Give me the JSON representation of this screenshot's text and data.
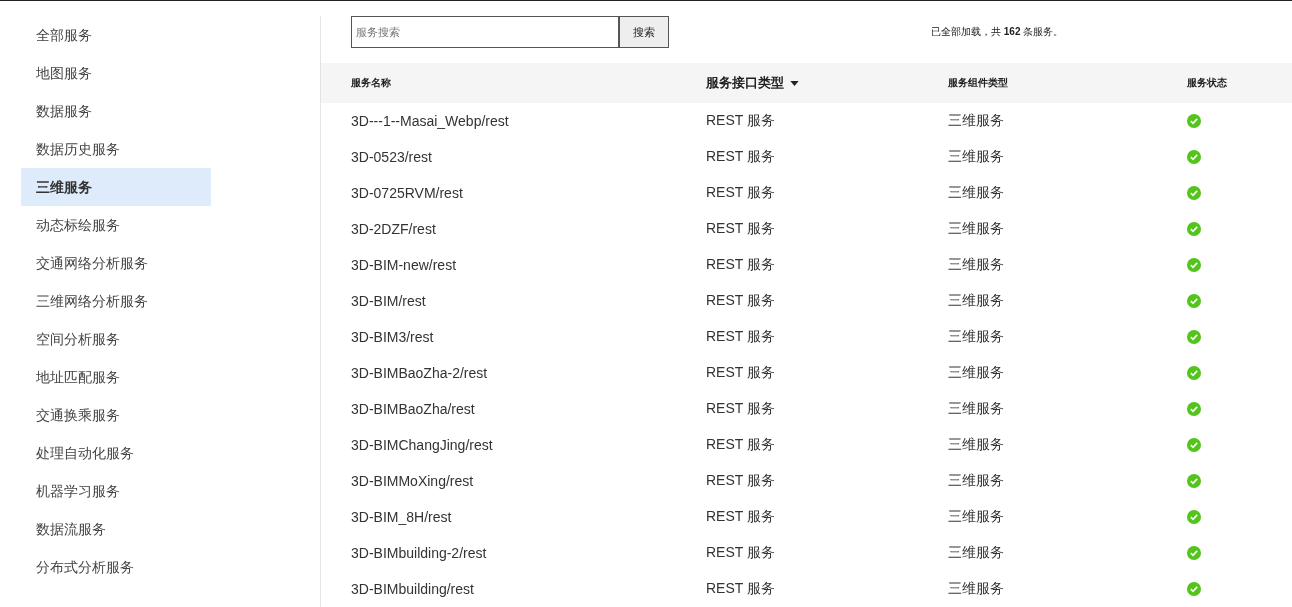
{
  "sidebar": {
    "items": [
      {
        "label": "全部服务",
        "selected": false
      },
      {
        "label": "地图服务",
        "selected": false
      },
      {
        "label": "数据服务",
        "selected": false
      },
      {
        "label": "数据历史服务",
        "selected": false
      },
      {
        "label": "三维服务",
        "selected": true
      },
      {
        "label": "动态标绘服务",
        "selected": false
      },
      {
        "label": "交通网络分析服务",
        "selected": false
      },
      {
        "label": "三维网络分析服务",
        "selected": false
      },
      {
        "label": "空间分析服务",
        "selected": false
      },
      {
        "label": "地址匹配服务",
        "selected": false
      },
      {
        "label": "交通换乘服务",
        "selected": false
      },
      {
        "label": "处理自动化服务",
        "selected": false
      },
      {
        "label": "机器学习服务",
        "selected": false
      },
      {
        "label": "数据流服务",
        "selected": false
      },
      {
        "label": "分布式分析服务",
        "selected": false
      }
    ]
  },
  "search": {
    "placeholder": "服务搜索",
    "button": "搜索"
  },
  "summary": "已全部加载，共 **162** 条服务。",
  "table": {
    "columns": [
      {
        "label": "服务名称",
        "sorted": false
      },
      {
        "label": "服务接口类型",
        "sorted": true
      },
      {
        "label": "服务组件类型",
        "sorted": false
      },
      {
        "label": "服务状态",
        "sorted": false
      }
    ],
    "rows": [
      {
        "name": "3D---1--Masai_Webp/rest",
        "interface": "REST 服务",
        "component": "三维服务",
        "online": true
      },
      {
        "name": "3D-0523/rest",
        "interface": "REST 服务",
        "component": "三维服务",
        "online": true
      },
      {
        "name": "3D-0725RVM/rest",
        "interface": "REST 服务",
        "component": "三维服务",
        "online": true
      },
      {
        "name": "3D-2DZF/rest",
        "interface": "REST 服务",
        "component": "三维服务",
        "online": true
      },
      {
        "name": "3D-BIM-new/rest",
        "interface": "REST 服务",
        "component": "三维服务",
        "online": true
      },
      {
        "name": "3D-BIM/rest",
        "interface": "REST 服务",
        "component": "三维服务",
        "online": true
      },
      {
        "name": "3D-BIM3/rest",
        "interface": "REST 服务",
        "component": "三维服务",
        "online": true
      },
      {
        "name": "3D-BIMBaoZha-2/rest",
        "interface": "REST 服务",
        "component": "三维服务",
        "online": true
      },
      {
        "name": "3D-BIMBaoZha/rest",
        "interface": "REST 服务",
        "component": "三维服务",
        "online": true
      },
      {
        "name": "3D-BIMChangJing/rest",
        "interface": "REST 服务",
        "component": "三维服务",
        "online": true
      },
      {
        "name": "3D-BIMMoXing/rest",
        "interface": "REST 服务",
        "component": "三维服务",
        "online": true
      },
      {
        "name": "3D-BIM_8H/rest",
        "interface": "REST 服务",
        "component": "三维服务",
        "online": true
      },
      {
        "name": "3D-BIMbuilding-2/rest",
        "interface": "REST 服务",
        "component": "三维服务",
        "online": true
      },
      {
        "name": "3D-BIMbuilding/rest",
        "interface": "REST 服务",
        "component": "三维服务",
        "online": true
      }
    ]
  }
}
